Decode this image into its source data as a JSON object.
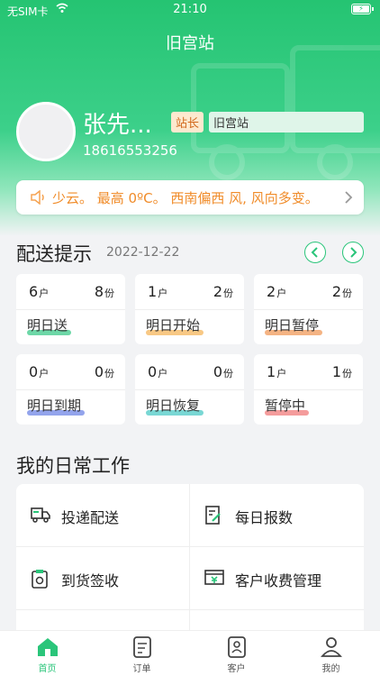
{
  "status_bar": {
    "carrier": "无SIM卡",
    "time": "21:10"
  },
  "header": {
    "title": "旧宫站",
    "user_name": "张先...",
    "role": "站长",
    "station": "旧宫站",
    "phone": "18616553256"
  },
  "weather": {
    "text": "少云。 最高 0ºC。 西南偏西 风, 风向多变。"
  },
  "delivery": {
    "title": "配送提示",
    "date": "2022-12-22",
    "unit_household": "户",
    "unit_portion": "份",
    "cards": [
      {
        "households": "6",
        "portions": "8",
        "label": "明日送",
        "color": "#3cc98a"
      },
      {
        "households": "1",
        "portions": "2",
        "label": "明日开始",
        "color": "#f5b65b"
      },
      {
        "households": "2",
        "portions": "2",
        "label": "明日暂停",
        "color": "#f09a5a"
      },
      {
        "households": "0",
        "portions": "0",
        "label": "明日到期",
        "color": "#6f86e6"
      },
      {
        "households": "0",
        "portions": "0",
        "label": "明日恢复",
        "color": "#4cc9c5"
      },
      {
        "households": "1",
        "portions": "1",
        "label": "暂停中",
        "color": "#f07b7b"
      }
    ]
  },
  "work": {
    "title": "我的日常工作",
    "items": [
      {
        "label": "投递配送",
        "icon": "truck-icon"
      },
      {
        "label": "每日报数",
        "icon": "report-icon"
      },
      {
        "label": "到货签收",
        "icon": "sign-icon"
      },
      {
        "label": "客户收费管理",
        "icon": "billing-icon"
      }
    ]
  },
  "tabbar": {
    "items": [
      {
        "label": "首页",
        "icon": "home-icon"
      },
      {
        "label": "订单",
        "icon": "order-icon"
      },
      {
        "label": "客户",
        "icon": "customer-icon"
      },
      {
        "label": "我的",
        "icon": "profile-icon"
      }
    ]
  },
  "colors": {
    "brand": "#2ac57a",
    "weather_text": "#f08c2a"
  }
}
